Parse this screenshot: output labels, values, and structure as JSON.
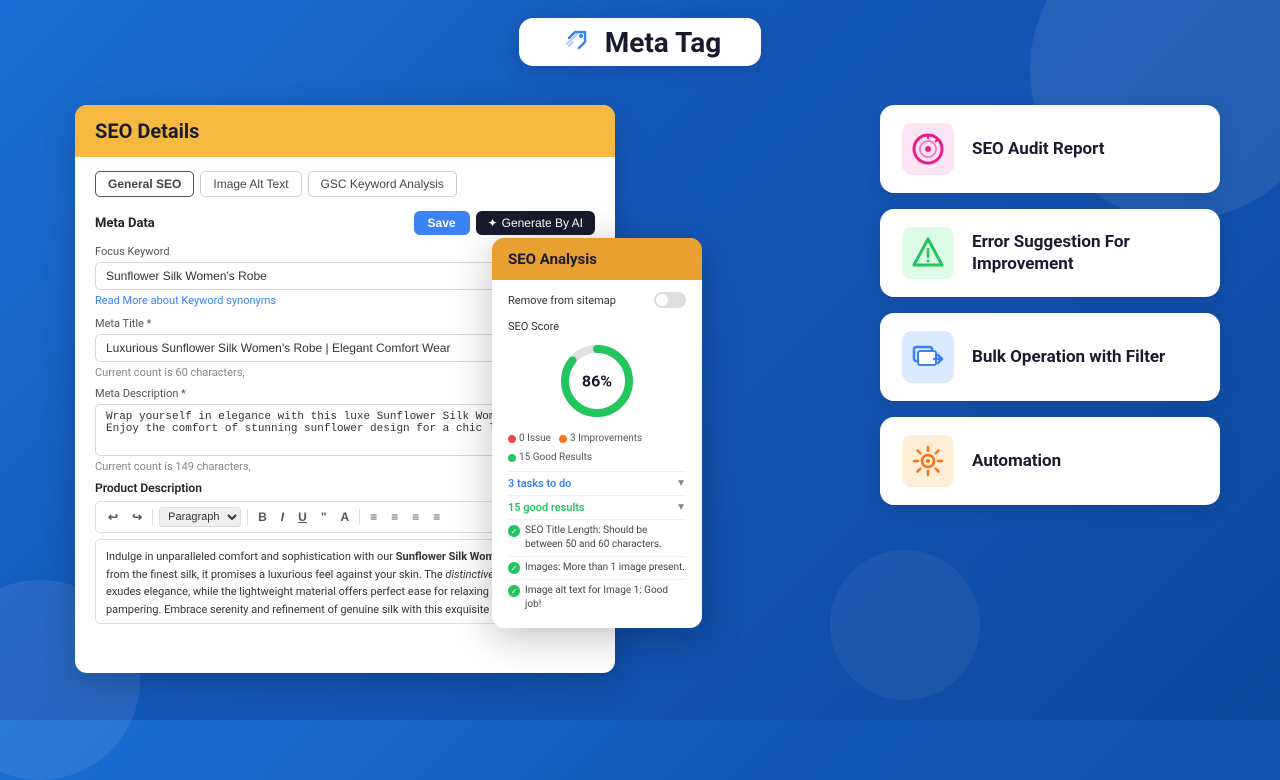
{
  "header": {
    "title": "Meta Tag",
    "logo_alt": "Meta Tag Logo"
  },
  "seo_details": {
    "title": "SEO Details",
    "tabs": [
      {
        "label": "General SEO",
        "active": true
      },
      {
        "label": "Image Alt Text",
        "active": false
      },
      {
        "label": "GSC Keyword Analysis",
        "active": false
      }
    ],
    "section_label": "Meta Data",
    "btn_save": "Save",
    "btn_generate": "Generate By AI",
    "focus_keyword_label": "Focus Keyword",
    "focus_keyword_value": "Sunflower Silk Women's Robe",
    "keyword_link": "Read More about Keyword synonyms",
    "meta_title_label": "Meta Title *",
    "meta_title_value": "Luxurious Sunflower Silk Women's Robe | Elegant Comfort Wear",
    "meta_title_hint": "Current count is 60 characters,",
    "meta_description_label": "Meta Description *",
    "meta_description_value": "Wrap yourself in elegance with this luxe Sunflower Silk Women's Robe. Enjoy the comfort of stunning sunflower design for a chic look.",
    "meta_description_hint": "Current count is 149 characters,",
    "product_description_label": "Product Description",
    "toolbar_items": [
      "↩",
      "↪",
      "Paragraph",
      "B",
      "I",
      "U",
      "\"",
      "A",
      "≡",
      "≡",
      "≡",
      "≡",
      "≡"
    ],
    "desc_content": "Indulge in unparalleled comfort and sophistication with our Sunflower Silk Women's Robe. Crafted from the finest silk, it promises a luxurious feel against your skin. The distinctive sunflower motif exudes elegance, while the lightweight material offers perfect ease for relaxing or post-shower pampering. Embrace serenity and refinement of genuine silk with this exquisite robe."
  },
  "seo_analysis": {
    "title": "SEO Analysis",
    "sitemap_label": "Remove from sitemap",
    "score_label": "SEO Score",
    "score_value": "86%",
    "score_number": 86,
    "badges": [
      {
        "label": "0 Issue",
        "color": "red"
      },
      {
        "label": "3 Improvements",
        "color": "orange"
      },
      {
        "label": "15 Good Results",
        "color": "green"
      }
    ],
    "tasks_todo_label": "3 tasks to do",
    "good_results_label": "15 good results",
    "results": [
      {
        "text": "SEO Title Length: Should be between 50 and 60 characters."
      },
      {
        "text": "Images: More than 1 image present."
      },
      {
        "text": "Image alt text for Image 1: Good job!"
      }
    ]
  },
  "features": [
    {
      "id": "seo-audit",
      "title": "SEO Audit Report",
      "icon_color": "#e91e8c",
      "icon_bg": "#fce4f3"
    },
    {
      "id": "error-suggestion",
      "title": "Error Suggestion For Improvement",
      "icon_color": "#22c55e",
      "icon_bg": "#dcfce7"
    },
    {
      "id": "bulk-operation",
      "title": "Bulk Operation with Filter",
      "icon_color": "#3b82f6",
      "icon_bg": "#dbeafe"
    },
    {
      "id": "automation",
      "title": "Automation",
      "icon_color": "#f97316",
      "icon_bg": "#ffedd5"
    }
  ]
}
